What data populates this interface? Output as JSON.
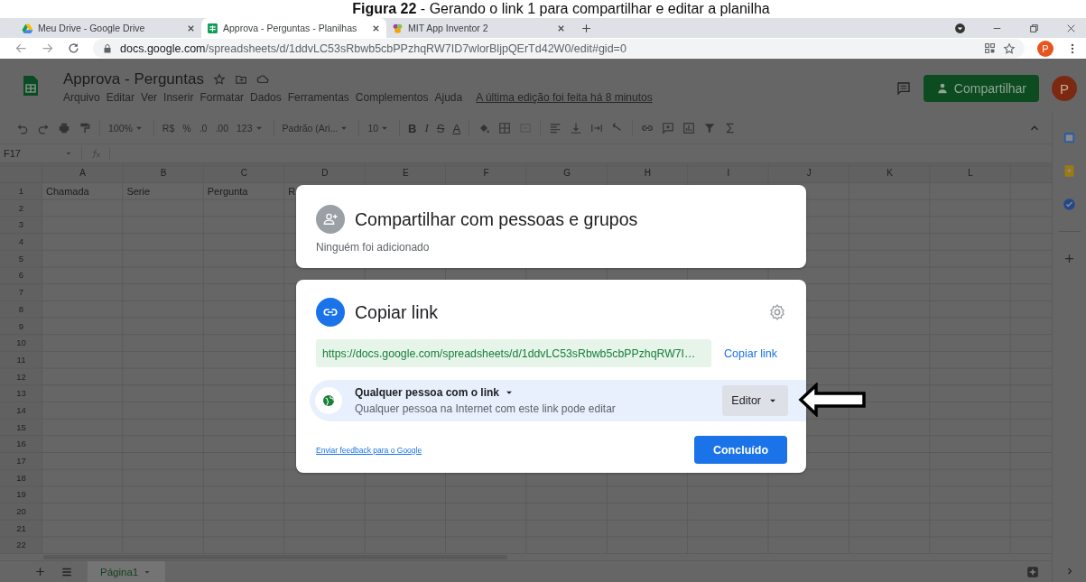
{
  "caption": "**Figura 22** - Gerando o link 1 para compartilhar e editar a planilha",
  "browser": {
    "tabs": [
      {
        "title": "Meu Drive - Google Drive",
        "selected": false
      },
      {
        "title": "Approva - Perguntas - Planilhas",
        "selected": true
      },
      {
        "title": "MIT App Inventor 2",
        "selected": false
      }
    ],
    "url_host": "docs.google.com",
    "url_path": "/spreadsheets/d/1ddvLC53sRbwb5cbPPzhqRW7ID7wlorBljpQErTd42W0/edit#gid=0",
    "profile_initial": "P"
  },
  "doc": {
    "title": "Approva - Perguntas",
    "menu": [
      "Arquivo",
      "Editar",
      "Ver",
      "Inserir",
      "Formatar",
      "Dados",
      "Ferramentas",
      "Complementos",
      "Ajuda"
    ],
    "last_edit": "A última edição foi feita há 8 minutos",
    "share_button": "Compartilhar",
    "avatar_initial": "P"
  },
  "toolbar": {
    "zoom": "100%",
    "currency": "R$",
    "percent": "%",
    "decimal_less": ".0",
    "decimal_more": ".00",
    "number_format": "123",
    "font": "Padrão (Ari...",
    "font_size": "10",
    "bold": "B",
    "italic": "I",
    "strike": "S",
    "text_color": "A"
  },
  "formula_bar": {
    "cell_ref": "F17"
  },
  "sheet": {
    "columns": [
      "A",
      "B",
      "C",
      "D",
      "E",
      "F",
      "G",
      "H",
      "I",
      "J",
      "K",
      "L"
    ],
    "rows": [
      {
        "number": "1",
        "cells": [
          "Chamada",
          "Serie",
          "Pergunta",
          "R"
        ]
      },
      {
        "number": "2"
      },
      {
        "number": "3"
      },
      {
        "number": "4"
      },
      {
        "number": "5"
      },
      {
        "number": "6"
      },
      {
        "number": "7"
      },
      {
        "number": "8"
      },
      {
        "number": "9"
      },
      {
        "number": "10"
      },
      {
        "number": "11"
      },
      {
        "number": "12"
      },
      {
        "number": "13"
      },
      {
        "number": "14"
      },
      {
        "number": "15"
      },
      {
        "number": "16"
      },
      {
        "number": "17"
      },
      {
        "number": "18"
      },
      {
        "number": "19"
      },
      {
        "number": "20"
      },
      {
        "number": "21"
      },
      {
        "number": "22"
      }
    ]
  },
  "sheet_tabs": [
    {
      "label": "Página1",
      "selected": true
    }
  ],
  "share_dialog": {
    "people": {
      "title": "Compartilhar com pessoas e grupos",
      "status": "Ninguém foi adicionado"
    },
    "link": {
      "title": "Copiar link",
      "url": "https://docs.google.com/spreadsheets/d/1ddvLC53sRbwb5cbPPzhqRW7I…",
      "copy_button": "Copiar link",
      "access": {
        "scope": "Qualquer pessoa com o link",
        "description": "Qualquer pessoa na Internet com este link pode editar",
        "role": "Editor"
      },
      "feedback_link": "Enviar feedback para o Google",
      "done_button": "Concluído"
    }
  }
}
